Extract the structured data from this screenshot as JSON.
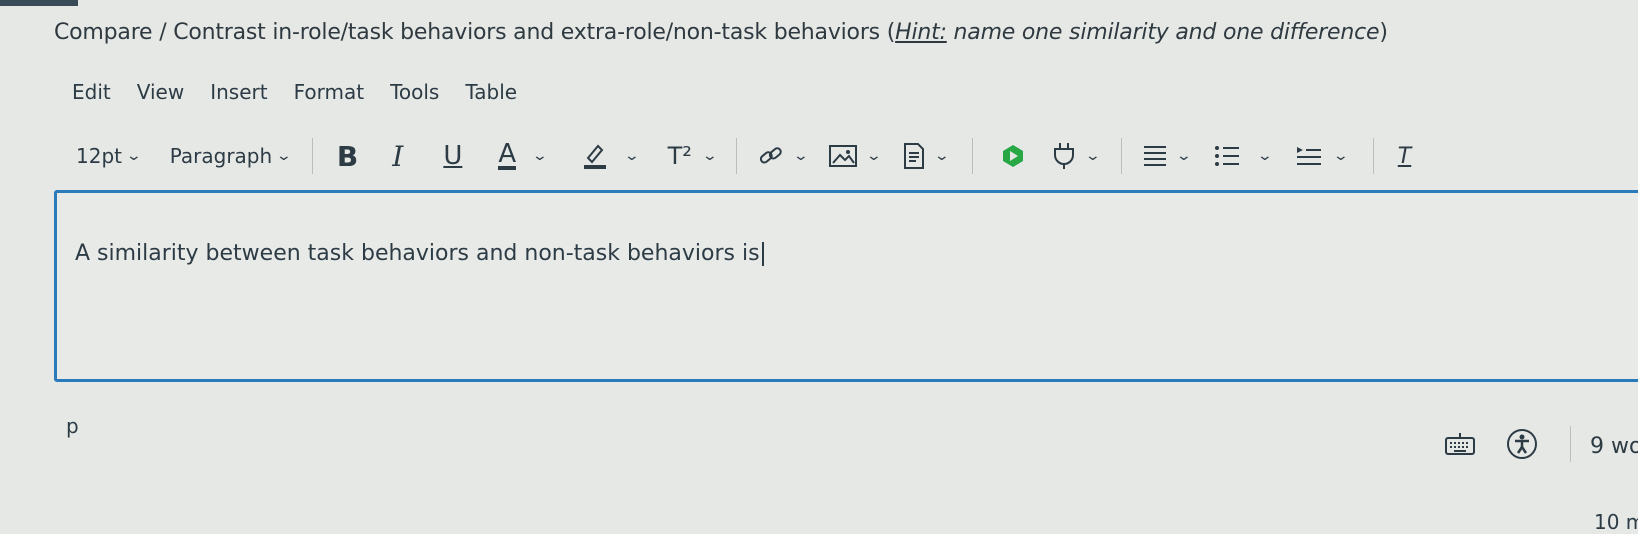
{
  "question": {
    "prefix": "Compare / Contrast in-role/task behaviors and extra-role/non-task behaviors (",
    "hint_label": "Hint:",
    "hint_text": " name one similarity and one difference",
    "suffix": ")"
  },
  "menubar": {
    "items": [
      "Edit",
      "View",
      "Insert",
      "Format",
      "Tools",
      "Table"
    ]
  },
  "toolbar": {
    "font_size": "12pt",
    "block_format": "Paragraph",
    "bold": "B",
    "italic": "I",
    "underline": "U",
    "text_color": "A",
    "superscript": "T²",
    "last_partial": "T"
  },
  "editor": {
    "content": "A similarity between task behaviors and non-task behaviors is"
  },
  "status": {
    "path": "p",
    "word_count": "9 wo",
    "minutes": "10 m"
  },
  "colors": {
    "accent": "#2b7abc",
    "text": "#2d3b45",
    "background": "#e6e8e6",
    "green_icon": "#27a844"
  }
}
